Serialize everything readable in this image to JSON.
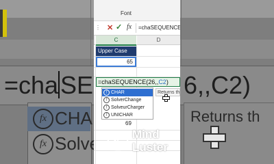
{
  "ribbon": {
    "group_label": "Font"
  },
  "formula_bar": {
    "cancel_symbol": "✕",
    "enter_symbol": "✓",
    "fx_label": "fx",
    "content": "=chaSEQUENCE("
  },
  "columns": {
    "c": "C",
    "d": "D"
  },
  "cells": {
    "header": "Upper Case",
    "value_1": "65",
    "value_2": "69"
  },
  "formula_cell": {
    "prefix": "=cha",
    "middle": "SEQUENCE(26,,",
    "ref": "C2",
    "suffix": ")"
  },
  "autocomplete": {
    "items": [
      {
        "label": "CHAR",
        "selected": true
      },
      {
        "label": "SolverChange",
        "selected": false
      },
      {
        "label": "SolveurCharger",
        "selected": false
      },
      {
        "label": "UNICHAR",
        "selected": false
      }
    ],
    "tooltip": "Returns th"
  },
  "background": {
    "formula_text_left": "=cha",
    "formula_text_mid": "SEQUE",
    "formula_text_right": "6,,C2)",
    "popup_item_1": "CHAR",
    "popup_item_2": "Solve",
    "tooltip": "Returns th"
  },
  "logo": {
    "line1": "Mind",
    "line2": "Luster"
  },
  "colors": {
    "accent_green": "#1d7b45",
    "selection_blue": "#2e6fd1",
    "header_navy": "#1f3b6e"
  }
}
